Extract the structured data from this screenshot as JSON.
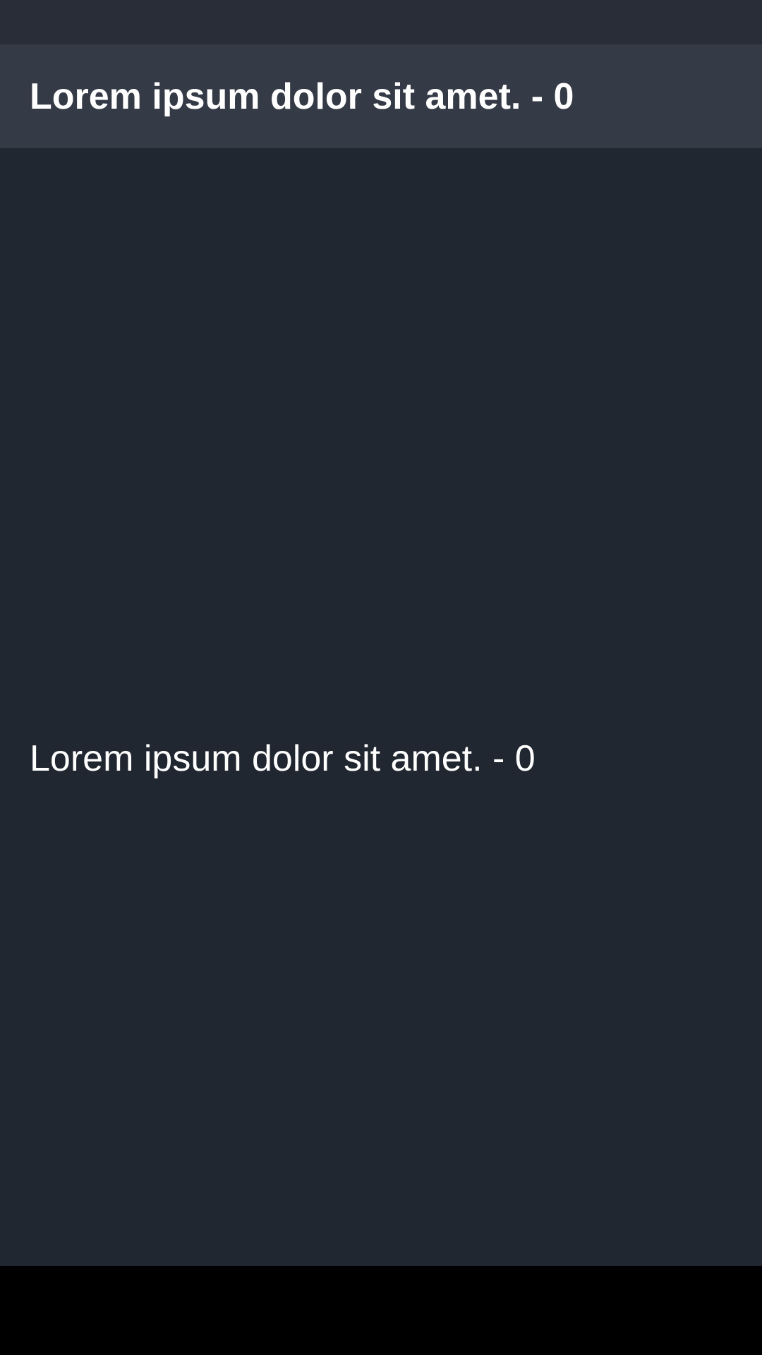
{
  "app_bar": {
    "title": "Lorem ipsum dolor sit amet. - 0"
  },
  "main": {
    "text": "Lorem ipsum dolor sit amet. - 0"
  },
  "colors": {
    "status_bar": "#282d37",
    "app_bar": "#343a46",
    "content_background": "#212730",
    "navigation_bar": "#000000",
    "text": "#ffffff"
  }
}
